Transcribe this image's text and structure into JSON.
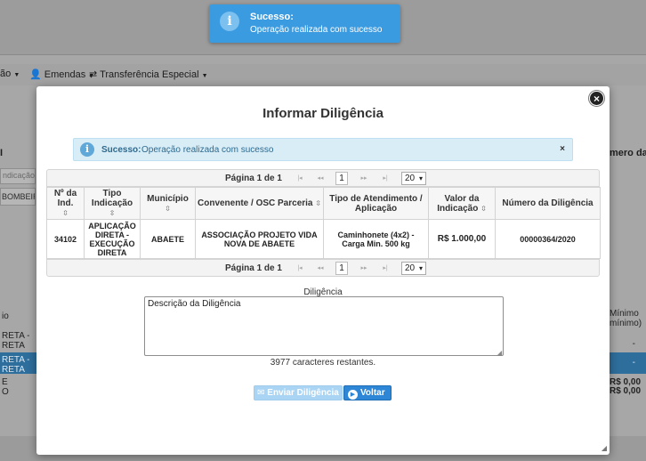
{
  "toast": {
    "title": "Sucesso:",
    "message": "Operação realizada com sucesso",
    "icon": "info-icon"
  },
  "background": {
    "menu": [
      {
        "label": "ão",
        "icon": "chevron-down-icon"
      },
      {
        "label": "Emendas",
        "icon": "user-icon"
      },
      {
        "label": "Transferência Especial",
        "icon": "transfer-icon"
      }
    ],
    "left_label": "I",
    "left_input_placeholder": "ndicação",
    "left_input_value": "BOMBEIRO",
    "left_rows": [
      "io",
      "RETA -",
      "RETA",
      "RETA -",
      "RETA",
      "E",
      "O"
    ],
    "right_label": "mero da ind",
    "right_rows": [
      "Mínimo",
      "mínimo)",
      "-",
      "-",
      "R$ 0,00",
      "R$ 0,00"
    ]
  },
  "modal": {
    "title": "Informar Diligência",
    "alert": {
      "title": "Sucesso:",
      "message": "Operação realizada com sucesso",
      "close": "×"
    },
    "paginator": {
      "label": "Página 1 de 1",
      "first": "|◂",
      "prev": "◂◂",
      "page": "1",
      "next": "▸▸",
      "last": "▸|",
      "page_size": "20"
    },
    "table": {
      "headers": [
        "Nº da Ind.",
        "Tipo Indicação",
        "Município",
        "Convenente / OSC Parceria",
        "Tipo de Atendimento / Aplicação",
        "Valor da Indicação",
        "Número da Diligência"
      ],
      "rows": [
        [
          "34102",
          "APLICAÇÃO DIRETA - EXECUÇÃO DIRETA",
          "ABAETE",
          "ASSOCIAÇÃO PROJETO VIDA NOVA DE ABAETE",
          "Caminhonete (4x2) - Carga Min. 500 kg",
          "R$ 1.000,00",
          "00000364/2020"
        ]
      ]
    },
    "diligencia_label": "Diligência",
    "diligencia_value": "Descrição da Diligência",
    "counter": "3977 caracteres restantes.",
    "send_button": "Enviar Diligência",
    "back_button": "Voltar"
  }
}
